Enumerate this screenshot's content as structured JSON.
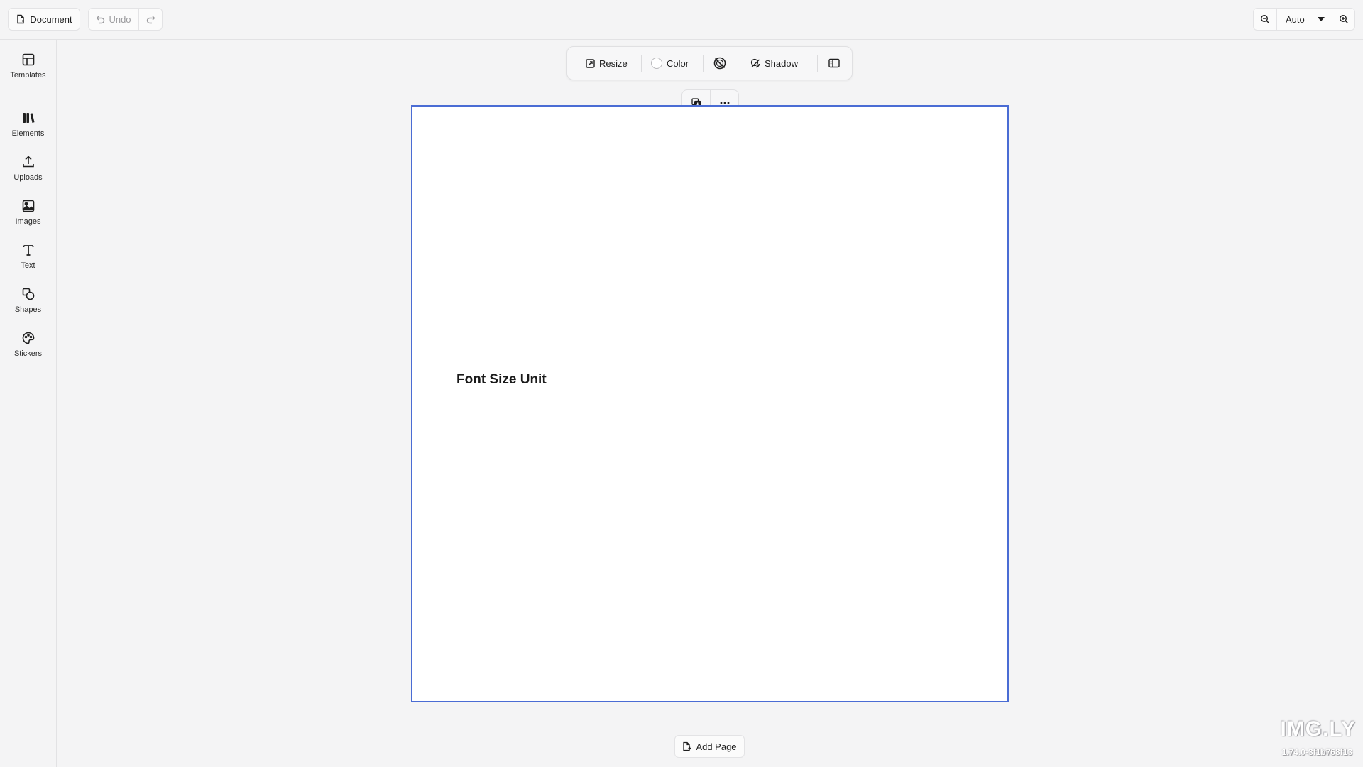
{
  "topbar": {
    "document_label": "Document",
    "undo_label": "Undo",
    "zoom_value": "Auto"
  },
  "sidebar": {
    "items": [
      {
        "label": "Templates",
        "icon": "templates-icon"
      },
      {
        "label": "Elements",
        "icon": "elements-icon"
      },
      {
        "label": "Uploads",
        "icon": "upload-icon"
      },
      {
        "label": "Images",
        "icon": "image-icon"
      },
      {
        "label": "Text",
        "icon": "text-icon"
      },
      {
        "label": "Shapes",
        "icon": "shapes-icon"
      },
      {
        "label": "Stickers",
        "icon": "sticker-icon"
      }
    ]
  },
  "canvas_toolbar": {
    "resize_label": "Resize",
    "color_label": "Color",
    "shadow_label": "Shadow"
  },
  "page": {
    "text": "Font Size Unit"
  },
  "add_page_label": "Add Page",
  "branding": {
    "logo_text": "IMG.LY",
    "version": "1.74.0-3f1b768f13"
  },
  "colors": {
    "selection_border": "#4a6cd4",
    "background": "#f4f4f5"
  }
}
